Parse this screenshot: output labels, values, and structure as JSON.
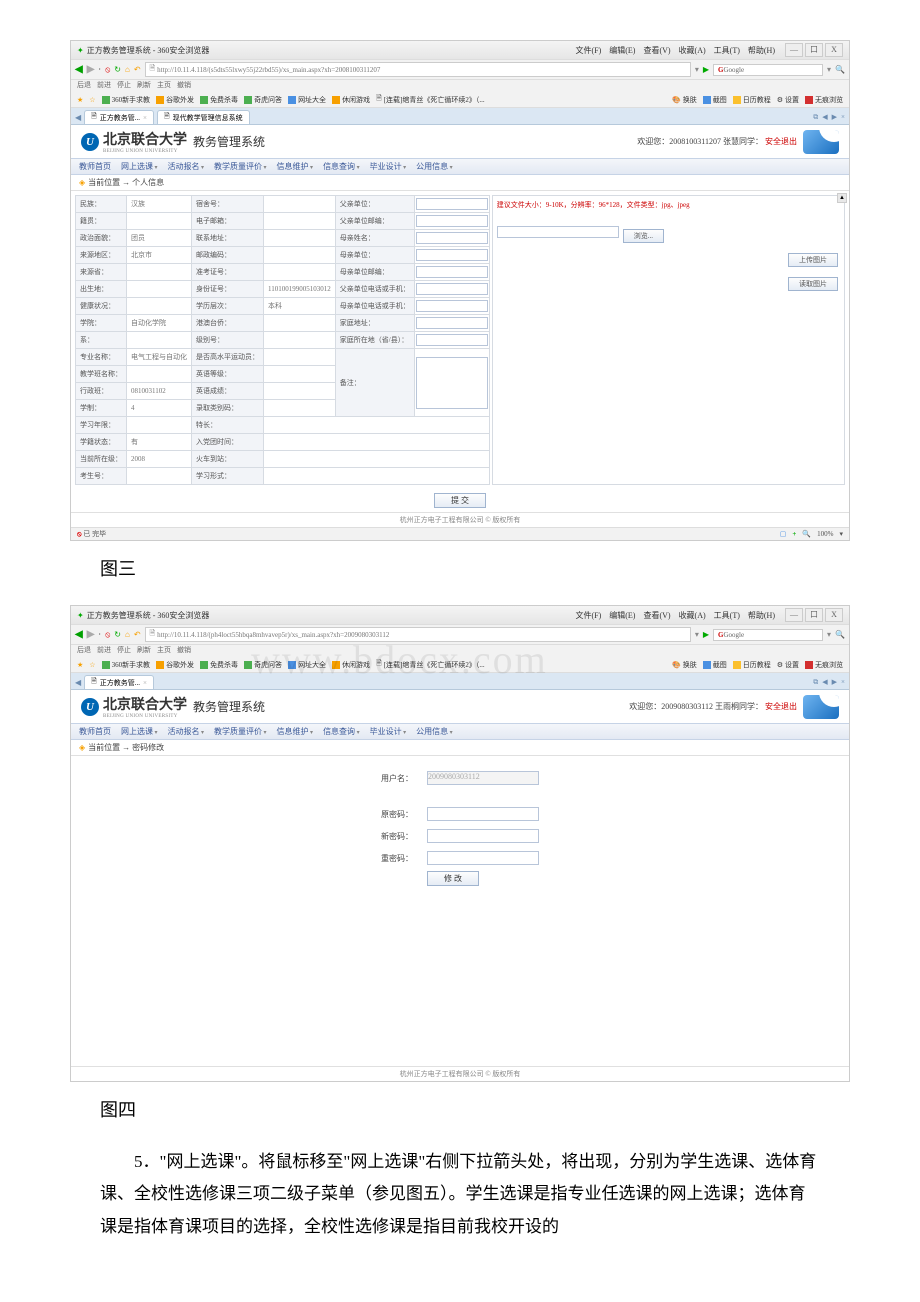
{
  "browserTitle": "正方教务管理系统 - 360安全浏览器",
  "menus": {
    "file": "文件(F)",
    "edit": "编辑(E)",
    "view": "查看(V)",
    "favorites": "收藏(A)",
    "tools": "工具(T)",
    "help": "帮助(H)"
  },
  "windowControls": {
    "min": "—",
    "restore": "口",
    "close": "X"
  },
  "navLabels": {
    "back": "后退",
    "forward": "前进",
    "stop": "停止",
    "refresh": "刷新",
    "home": "主页",
    "restore": "撤销"
  },
  "url1": "http://10.11.4.118/(s5dts55lxwy55j22rbd55)/xs_main.aspx?xh=2008100311207",
  "url2": "http://10.11.4.118/(ph4loct55hbqa8mhvavep5r)/xs_main.aspx?xh=2009080303112",
  "searchEngine": "Google",
  "searchGlass": "🔍",
  "bookmarks": {
    "star": "★",
    "items": [
      "360新手求教",
      "谷歌外发",
      "免费杀毒",
      "奇虎问答",
      "网址大全",
      "休闲游戏",
      "[连载]绾青丝《死亡循环续2》（...",
      "[连载]绾青丝《死亡循环续2》（..."
    ],
    "right": [
      "换肤",
      "截图",
      "日历教程",
      "设置",
      "无痕浏览"
    ]
  },
  "tab": {
    "title": "正方教务管...",
    "title2": "现代教学管理信息系统"
  },
  "university": {
    "name": "北京联合大学",
    "sub": "BEIJING UNION UNIVERSITY",
    "system": "教务管理系统"
  },
  "welcome1": "欢迎您：2008100311207 张慧同学：",
  "welcome2": "欢迎您：2009080303112 王雨桐同学：",
  "logout": "安全退出",
  "sysMenu": [
    "教师首页",
    "网上选课",
    "活动报名",
    "教学质量评价",
    "信息维护",
    "信息查询",
    "毕业设计",
    "公用信息"
  ],
  "bc1": "当前位置 → 个人信息",
  "bc2": "当前位置 → 密码修改",
  "form": {
    "r1": {
      "l1": "民族：",
      "v1": "汉族",
      "l2": "宿舍号：",
      "v2": "",
      "l3": "父亲单位：",
      "v3": ""
    },
    "r2": {
      "l1": "籍贯：",
      "v1": "",
      "l2": "电子邮箱：",
      "v2": "",
      "l3": "父亲单位邮编：",
      "v3": ""
    },
    "r3": {
      "l1": "政治面貌：",
      "v1": "团员",
      "l2": "联系地址：",
      "v2": "",
      "l3": "母亲姓名：",
      "v3": ""
    },
    "r4": {
      "l1": "来源地区：",
      "v1": "北京市",
      "l2": "邮政编码：",
      "v2": "",
      "l3": "母亲单位：",
      "v3": ""
    },
    "r5": {
      "l1": "来源省：",
      "v1": "",
      "l2": "准考证号：",
      "v2": "",
      "l3": "母亲单位邮编：",
      "v3": ""
    },
    "r6": {
      "l1": "出生地：",
      "v1": "",
      "l2": "身份证号：",
      "v2": "110100199005103012",
      "l3": "父亲单位电话或手机：",
      "v3": ""
    },
    "r7": {
      "l1": "健康状况：",
      "v1": "",
      "l2": "学历层次：",
      "v2": "本科",
      "l3": "母亲单位电话或手机：",
      "v3": ""
    },
    "r8": {
      "l1": "学院：",
      "v1": "自动化学院",
      "l2": "港澳台侨：",
      "v2": "",
      "l3": "家庭地址：",
      "v3": ""
    },
    "r9": {
      "l1": "系：",
      "v1": "",
      "l2": "级别号：",
      "v2": "",
      "l3": "家庭所在地（省/县）："
    },
    "r10": {
      "l1": "专业名称：",
      "v1": "电气工程与自动化",
      "l2": "是否高水平运动员：",
      "v2": ""
    },
    "r11": {
      "l1": "教学班名称：",
      "v1": "",
      "l2": "英语等级：",
      "v2": ""
    },
    "r12": {
      "l1": "行政班：",
      "v1": "0810031102",
      "l2": "英语成绩：",
      "v2": ""
    },
    "r13": {
      "l1": "学制：",
      "v1": "4",
      "l2": "录取类别码：",
      "v2": ""
    },
    "r14": {
      "l1": "学习年限：",
      "v1": "",
      "l2": "特长：",
      "v2": ""
    },
    "r15": {
      "l1": "学籍状态：",
      "v1": "有",
      "l2": "入党团时间：",
      "v2": ""
    },
    "r16": {
      "l1": "当前所在级：",
      "v1": "2008",
      "l2": "火车到站：",
      "v2": ""
    },
    "r17": {
      "l1": "考生号：",
      "v1": "",
      "l2": "学习形式：",
      "v2": ""
    },
    "remark": "备注："
  },
  "rightPanel": {
    "note": "建议文件大小：9-10K，分辨率：96*128，文件类型：jpg、jpeg",
    "browse": "浏览...",
    "upload": "上传图片",
    "restore": "读取图片"
  },
  "submit": "提  交",
  "footer": "杭州正方电子工程有限公司 © 版权所有",
  "statusLeft": "已 完毕",
  "statusRight": "100%",
  "pw": {
    "user": "用户名：",
    "userVal": "2009080303112",
    "old": "原密码：",
    "new": "新密码：",
    "confirm": "重密码：",
    "btn": "修  改"
  },
  "captions": {
    "fig3": "图三",
    "fig4": "图四"
  },
  "paragraph": "5．\"网上选课\"。将鼠标移至\"网上选课\"右侧下拉箭头处，将出现，分别为学生选课、选体育课、全校性选修课三项二级子菜单（参见图五）。学生选课是指专业任选课的网上选课；选体育课是指体育课项目的选择，全校性选修课是指目前我校开设的",
  "watermark": "www.bdocx.com"
}
